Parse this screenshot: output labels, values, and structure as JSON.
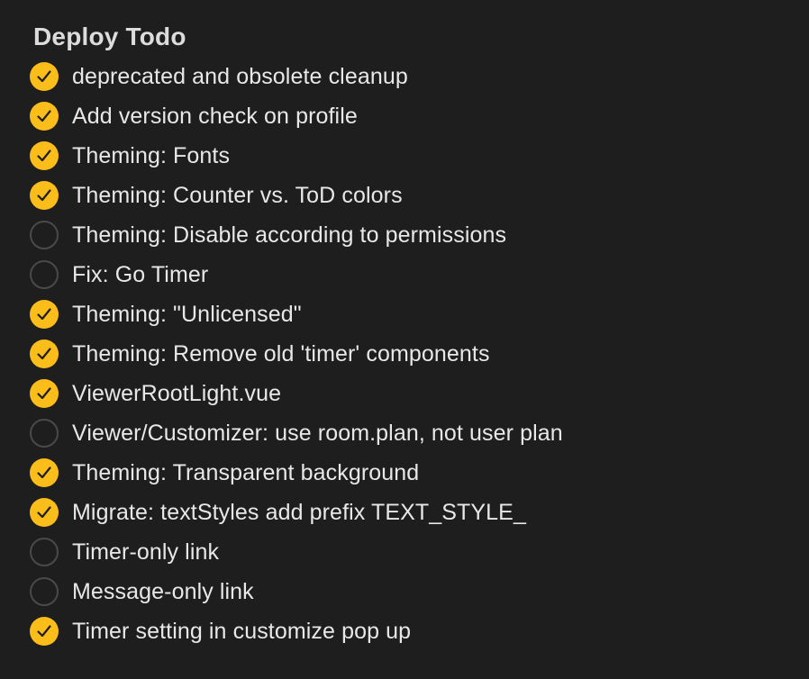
{
  "list": {
    "title": "Deploy Todo",
    "accent_color": "#fbbd1a",
    "items": [
      {
        "label": "deprecated and obsolete cleanup",
        "checked": true
      },
      {
        "label": "Add version check on profile",
        "checked": true
      },
      {
        "label": "Theming: Fonts",
        "checked": true
      },
      {
        "label": "Theming: Counter vs. ToD colors",
        "checked": true
      },
      {
        "label": "Theming: Disable according to permissions",
        "checked": false
      },
      {
        "label": "Fix: Go Timer",
        "checked": false
      },
      {
        "label": "Theming: \"Unlicensed\"",
        "checked": true
      },
      {
        "label": "Theming: Remove old 'timer' components",
        "checked": true
      },
      {
        "label": "ViewerRootLight.vue",
        "checked": true
      },
      {
        "label": "Viewer/Customizer: use room.plan, not user plan",
        "checked": false
      },
      {
        "label": "Theming: Transparent background",
        "checked": true
      },
      {
        "label": "Migrate: textStyles add prefix TEXT_STYLE_",
        "checked": true
      },
      {
        "label": "Timer-only link",
        "checked": false
      },
      {
        "label": "Message-only link",
        "checked": false
      },
      {
        "label": "Timer setting in customize pop up",
        "checked": true
      }
    ]
  }
}
